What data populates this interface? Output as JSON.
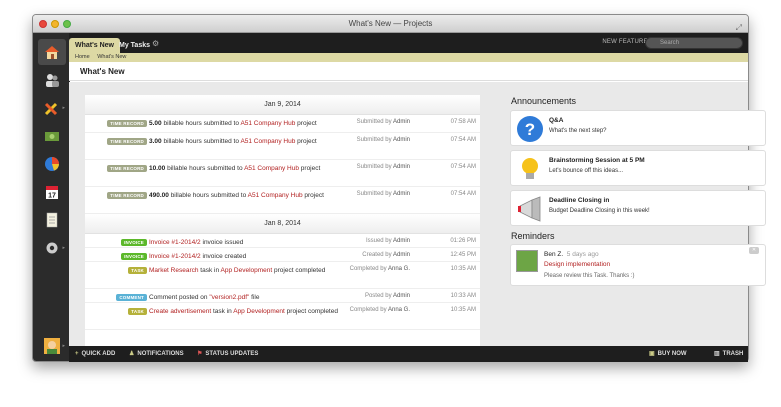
{
  "window": {
    "title": "What's New — Projects"
  },
  "topbar": {
    "tabs": [
      {
        "label": "What's New"
      },
      {
        "label": "My Tasks"
      }
    ],
    "new_features": "NEW FEATURES",
    "help": "?",
    "search_placeholder": "Search"
  },
  "breadcrumb": [
    "Home",
    "What's New"
  ],
  "page_title": "What's New",
  "feed": {
    "days": [
      {
        "date": "Jan 9, 2014",
        "items": [
          {
            "badge": "TIME RECORD",
            "kind": "time",
            "pre": "",
            "bold": "5.00",
            "mid": " billable hours submitted to ",
            "link": "A51 Company Hub",
            "post": " project",
            "link2": "",
            "post2": "",
            "by_label": "Submitted by",
            "by": "Admin",
            "time": "07:58 AM"
          },
          {
            "badge": "TIME RECORD",
            "kind": "time",
            "pre": "",
            "bold": "3.00",
            "mid": " billable hours submitted to ",
            "link": "A51 Company Hub",
            "post": " project",
            "link2": "",
            "post2": "",
            "by_label": "Submitted by",
            "by": "Admin",
            "time": "07:54 AM"
          },
          {
            "badge": "TIME RECORD",
            "kind": "time",
            "pre": "",
            "bold": "10.00",
            "mid": " billable hours submitted to ",
            "link": "A51 Company Hub",
            "post": " project",
            "link2": "",
            "post2": "",
            "by_label": "Submitted by",
            "by": "Admin",
            "time": "07:54 AM"
          },
          {
            "badge": "TIME RECORD",
            "kind": "time",
            "pre": "",
            "bold": "490.00",
            "mid": " billable hours submitted to ",
            "link": "A51 Company Hub",
            "post": " project",
            "link2": "",
            "post2": "",
            "by_label": "Submitted by",
            "by": "Admin",
            "time": "07:54 AM"
          }
        ]
      },
      {
        "date": "Jan 8, 2014",
        "items": [
          {
            "badge": "INVOICE",
            "kind": "invoice",
            "pre": "",
            "bold": "",
            "mid": "",
            "link": "Invoice #1-2014/2",
            "post": " invoice issued",
            "link2": "",
            "post2": "",
            "by_label": "Issued by",
            "by": "Admin",
            "time": "01:26 PM"
          },
          {
            "badge": "INVOICE",
            "kind": "invoice",
            "pre": "",
            "bold": "",
            "mid": "",
            "link": "Invoice #1-2014/2",
            "post": " invoice created",
            "link2": "",
            "post2": "",
            "by_label": "Created by",
            "by": "Admin",
            "time": "12:45 PM"
          },
          {
            "badge": "TASK",
            "kind": "task",
            "pre": "",
            "bold": "",
            "mid": "",
            "link": "Market Research",
            "post": " task in ",
            "link2": "App Development",
            "post2": " project completed",
            "by_label": "Completed by",
            "by": "Anna G.",
            "time": "10:35 AM"
          },
          {
            "badge": "COMMENT",
            "kind": "comment",
            "pre": "Comment posted on ",
            "bold": "",
            "mid": "",
            "link": "\"version2.pdf\"",
            "post": " file",
            "link2": "",
            "post2": "",
            "by_label": "Posted by",
            "by": "Admin",
            "time": "10:33 AM"
          },
          {
            "badge": "TASK",
            "kind": "task",
            "pre": "",
            "bold": "",
            "mid": "",
            "link": "Create advertisement",
            "post": " task in ",
            "link2": "App Development",
            "post2": " project completed",
            "by_label": "Completed by",
            "by": "Anna G.",
            "time": "10:35 AM"
          }
        ]
      }
    ]
  },
  "announcements": {
    "title": "Announcements",
    "items": [
      {
        "icon": "question-icon",
        "title": "Q&A",
        "desc": "What's the next step?"
      },
      {
        "icon": "lightbulb-icon",
        "title": "Brainstorming Session at 5 PM",
        "desc": "Let's bounce off this ideas..."
      },
      {
        "icon": "megaphone-icon",
        "title": "Deadline Closing in",
        "desc": "Budget Deadline Closing in this week!"
      }
    ]
  },
  "reminders": {
    "title": "Reminders",
    "items": [
      {
        "name": "Ben Z.",
        "ago": "5 days ago",
        "link": "Design implementation",
        "message": "Please review this Task. Thanks :)"
      }
    ]
  },
  "bottombar": {
    "quick_add": "QUICK ADD",
    "notifications": "NOTIFICATIONS",
    "status_updates": "STATUS UPDATES",
    "buy_now": "BUY NOW",
    "trash": "TRASH"
  },
  "colors": {
    "accent": "#ddd9a4",
    "link": "#b22222",
    "dark": "#1e1e1e"
  }
}
